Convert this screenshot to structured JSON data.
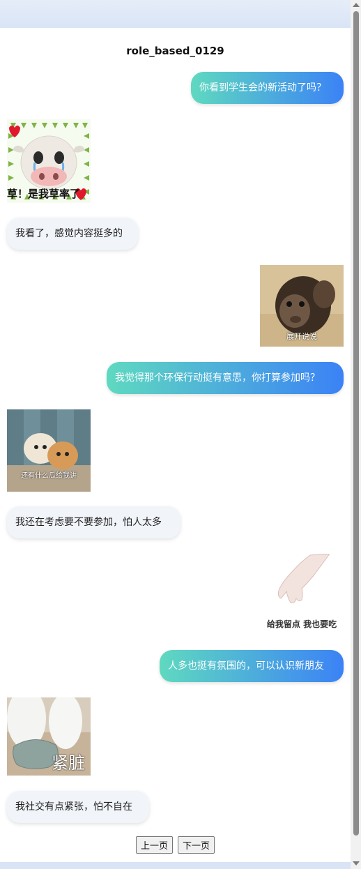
{
  "title": "role_based_0129",
  "messages": {
    "m1": "你看到学生会的新活动了吗？",
    "m3": "我看了，感觉内容挺多的",
    "m5": "我觉得那个环保行动挺有意思，你打算参加吗？",
    "m7": "我还在考虑要不要参加，怕人太多",
    "m9": "人多也挺有氛围的，可以认识新朋友",
    "m11": "我社交有点紧张，怕不自在"
  },
  "stickers": {
    "cow": {
      "icon": "crying-cow-sticker",
      "caption": "草！是我草率了"
    },
    "monkey": {
      "icon": "monkey-sticker",
      "caption": "展开说说"
    },
    "puppies": {
      "icon": "puppies-sticker",
      "caption": "还有什么瓜给我讲"
    },
    "hand": {
      "icon": "gloved-hand-sticker",
      "caption": "给我留点 我也要吃"
    },
    "slipper": {
      "icon": "cat-slipper-sticker",
      "caption": "紧脏"
    }
  },
  "pager": {
    "prev": "上一页",
    "next": "下一页"
  }
}
